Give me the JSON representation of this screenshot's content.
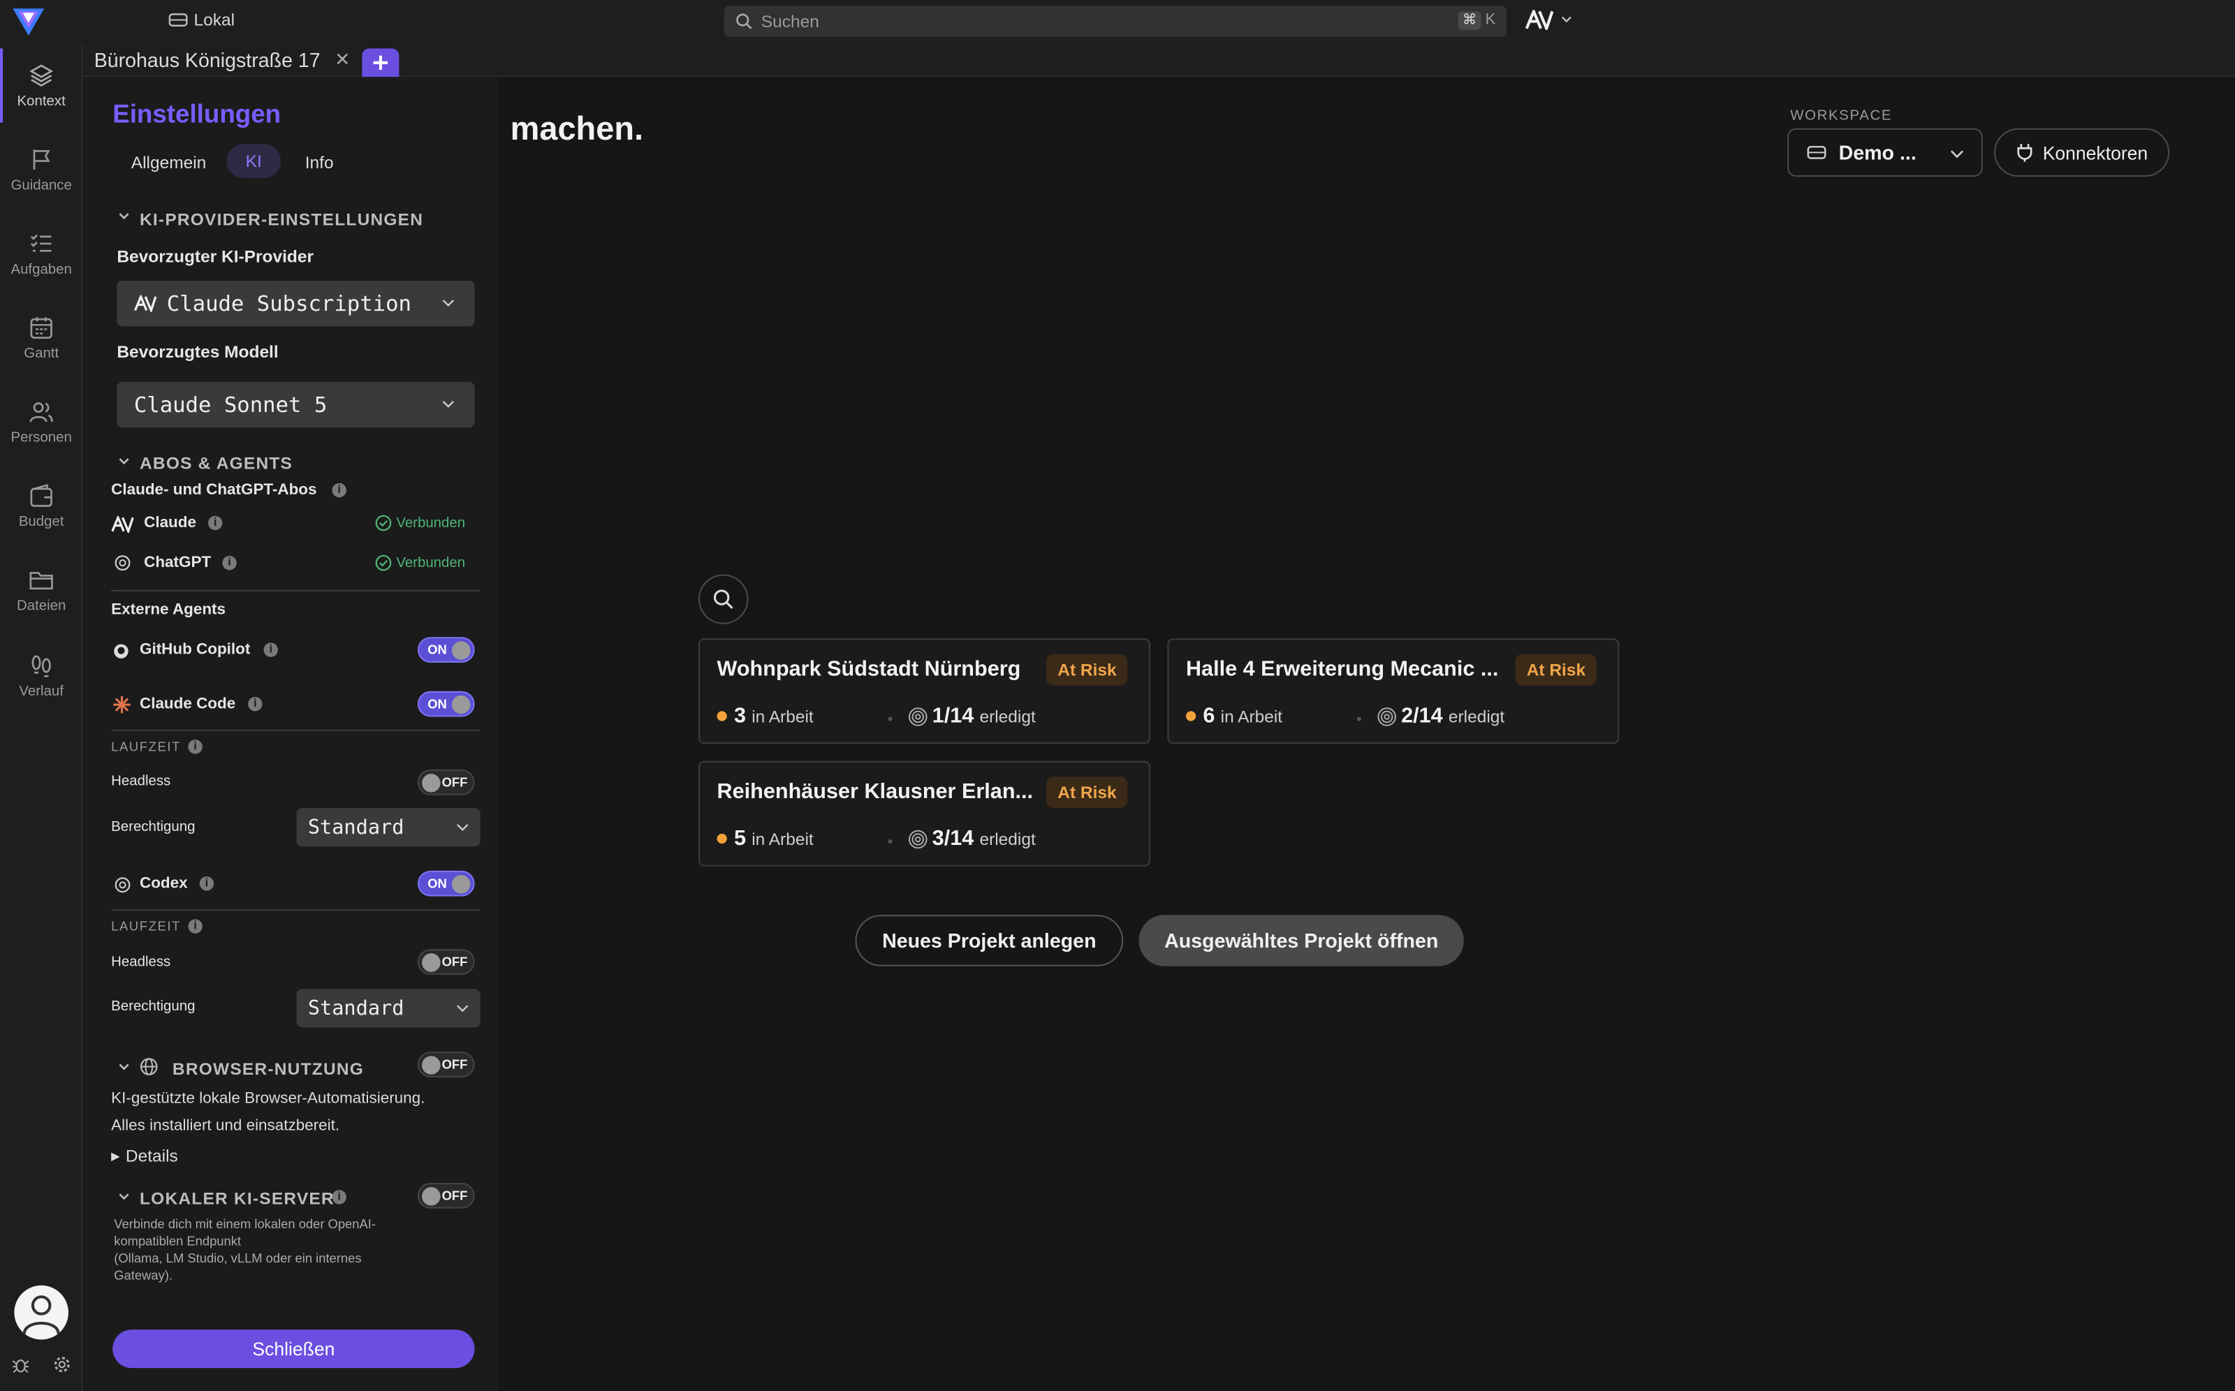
{
  "topbar": {
    "location": "Lokal",
    "search_placeholder": "Suchen",
    "shortcut_key": "K",
    "shortcut_mod": "⌘"
  },
  "tabs": [
    {
      "label": "Bürohaus Königstraße 17"
    }
  ],
  "rail": [
    {
      "label": "Kontext",
      "icon": "layers-icon"
    },
    {
      "label": "Guidance",
      "icon": "flag-icon"
    },
    {
      "label": "Aufgaben",
      "icon": "tasklist-icon"
    },
    {
      "label": "Gantt",
      "icon": "calendar-icon"
    },
    {
      "label": "Personen",
      "icon": "people-icon"
    },
    {
      "label": "Budget",
      "icon": "wallet-icon"
    },
    {
      "label": "Dateien",
      "icon": "folder-icon"
    },
    {
      "label": "Verlauf",
      "icon": "footsteps-icon"
    }
  ],
  "settings": {
    "title": "Einstellungen",
    "tabs": [
      "Allgemein",
      "KI",
      "Info"
    ],
    "active_tab": "KI",
    "provider_section": "KI-PROVIDER-EINSTELLUNGEN",
    "preferred_provider_label": "Bevorzugter KI-Provider",
    "preferred_provider_value": "Claude Subscription",
    "preferred_model_label": "Bevorzugtes Modell",
    "preferred_model_value": "Claude Sonnet 5",
    "abos_section": "ABOS & AGENTS",
    "abos_label": "Claude- und ChatGPT-Abos",
    "claude_label": "Claude",
    "chatgpt_label": "ChatGPT",
    "connected": "Verbunden",
    "external_agents": "Externe Agents",
    "copilot_label": "GitHub Copilot",
    "claude_code_label": "Claude Code",
    "codex_label": "Codex",
    "runtime_label": "LAUFZEIT",
    "headless_label": "Headless",
    "permission_label": "Berechtigung",
    "permission_value": "Standard",
    "on": "ON",
    "off": "OFF",
    "browser_section": "BROWSER-NUTZUNG",
    "browser_desc_1": "KI-gestützte lokale Browser-Automatisierung.",
    "browser_desc_2": "Alles installiert und einsatzbereit.",
    "details": "Details",
    "local_section": "LOKALER KI-SERVER",
    "local_desc_1": "Verbinde dich mit einem lokalen oder OpenAI-",
    "local_desc_2": "kompatiblen Endpunkt",
    "local_desc_3": "(Ollama, LM Studio, vLLM oder ein internes",
    "local_desc_4": "Gateway).",
    "close": "Schließen"
  },
  "main": {
    "heading": "machen.",
    "workspace_label": "WORKSPACE",
    "workspace_value": "Demo ...",
    "connectors": "Konnektoren",
    "projects": [
      {
        "name": "Wohnpark Südstadt Nürnberg",
        "status": "At Risk",
        "in_progress": "3",
        "in_progress_label": "in Arbeit",
        "done": "1/14",
        "done_label": "erledigt"
      },
      {
        "name": "Halle 4 Erweiterung Mecanic ...",
        "status": "At Risk",
        "in_progress": "6",
        "in_progress_label": "in Arbeit",
        "done": "2/14",
        "done_label": "erledigt"
      },
      {
        "name": "Reihenhäuser Klausner Erlan...",
        "status": "At Risk",
        "in_progress": "5",
        "in_progress_label": "in Arbeit",
        "done": "3/14",
        "done_label": "erledigt"
      }
    ],
    "new_project": "Neues Projekt anlegen",
    "open_project": "Ausgewähltes Projekt öffnen"
  },
  "colors": {
    "accent": "#7a5cff",
    "risk": "#f2a64a",
    "connected": "#4fb477"
  }
}
